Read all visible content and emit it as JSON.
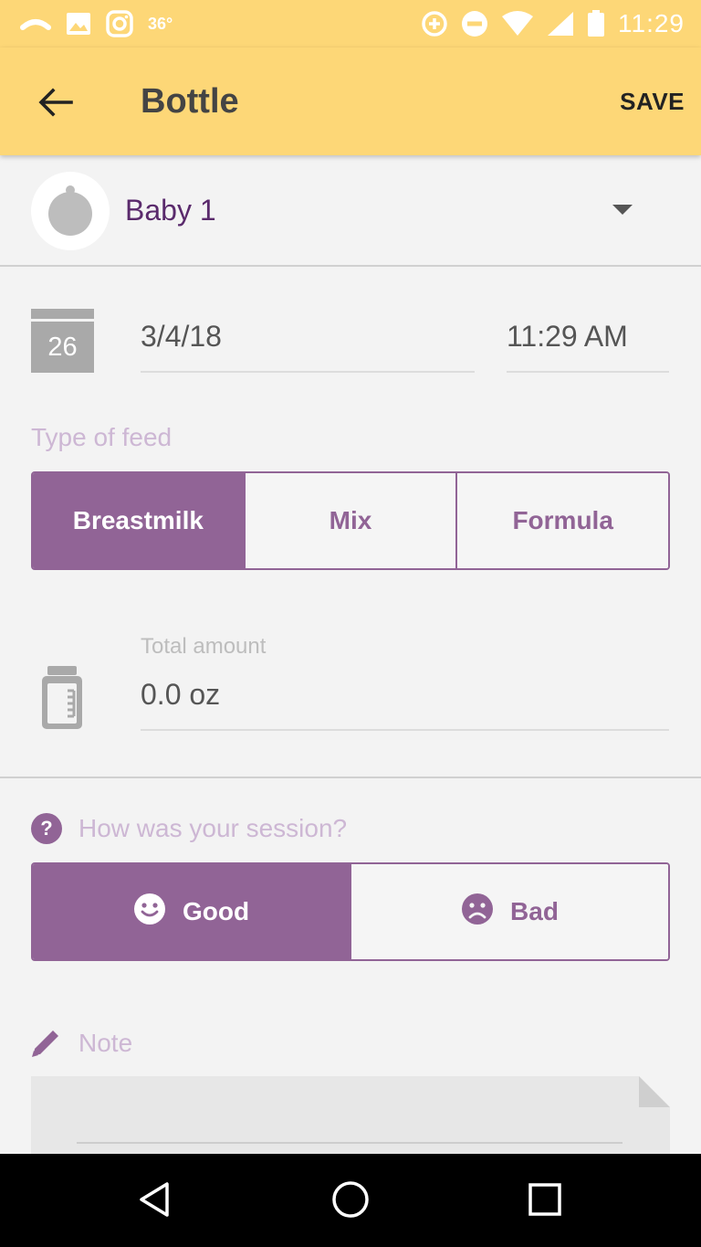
{
  "status_bar": {
    "temperature": "36°",
    "time": "11:29"
  },
  "app_bar": {
    "title": "Bottle",
    "save_label": "SAVE",
    "background_color": "#fdd777"
  },
  "baby": {
    "name": "Baby 1"
  },
  "date_time": {
    "calendar_day": "26",
    "date": "3/4/18",
    "time": "11:29 AM"
  },
  "feed_type": {
    "label": "Type of feed",
    "options": [
      "Breastmilk",
      "Mix",
      "Formula"
    ],
    "selected": "Breastmilk"
  },
  "amount": {
    "label": "Total amount",
    "value": "0.0 oz"
  },
  "session": {
    "question": "How was your session?",
    "question_icon": "?",
    "options": [
      "Good",
      "Bad"
    ],
    "selected": "Good"
  },
  "note": {
    "label": "Note",
    "value": ""
  },
  "colors": {
    "accent": "#916496",
    "label_muted": "#cdb7d4",
    "baby_name": "#5a2a6c"
  },
  "icons": {
    "back": "arrow-left-icon",
    "calendar": "calendar-icon",
    "bottle": "bottle-icon",
    "good": "smile-icon",
    "bad": "frown-icon",
    "note": "pencil-icon"
  }
}
